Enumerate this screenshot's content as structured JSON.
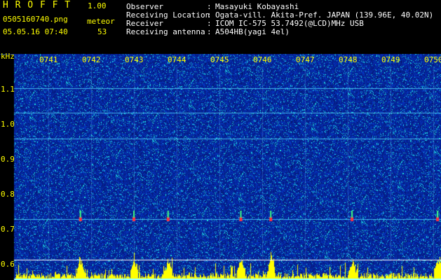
{
  "header": {
    "app_name": "H R O F F T",
    "version": "1.00",
    "filename": "0505160740.png",
    "mode_label": "meteor",
    "datetime": "05.05.16 07:40",
    "count": "53",
    "info": [
      {
        "label": "Observer",
        "sep": ":",
        "value": "Masayuki Kobayashi"
      },
      {
        "label": "Receiving Location",
        "sep": ":",
        "value": "Ogata-vill. Akita-Pref. JAPAN (139.96E, 40.02N)"
      },
      {
        "label": "Receiver",
        "sep": ":",
        "value": "ICOM IC-575 53.7492(@LCD)MHz USB"
      },
      {
        "label": "Receiving antenna",
        "sep": ":",
        "value": "A504HB(yagi 4el)"
      }
    ]
  },
  "spectrogram": {
    "y_unit": "kHz",
    "y_ticks": [
      "1.1",
      "1.0",
      "0.9",
      "0.8",
      "0.7",
      "0.6"
    ],
    "y_values": [
      1.1,
      1.0,
      0.9,
      0.8,
      0.7,
      0.6
    ],
    "time_ticks": [
      "0741",
      "0742",
      "0743",
      "0744",
      "0745",
      "0746",
      "0747",
      "0748",
      "0749",
      "0750"
    ],
    "carriers_khz": [
      1.105,
      1.035,
      0.96,
      0.73
    ],
    "meteor_minutes": [
      0.75,
      2.0,
      2.8,
      4.5,
      5.2,
      7.1,
      9.1,
      9.5
    ],
    "colors": {
      "background": "#000000",
      "label": "#ffff00",
      "noise_base": "#0a1e8c",
      "carrier": "#50d8ff",
      "meteor": "#ff3040"
    }
  }
}
